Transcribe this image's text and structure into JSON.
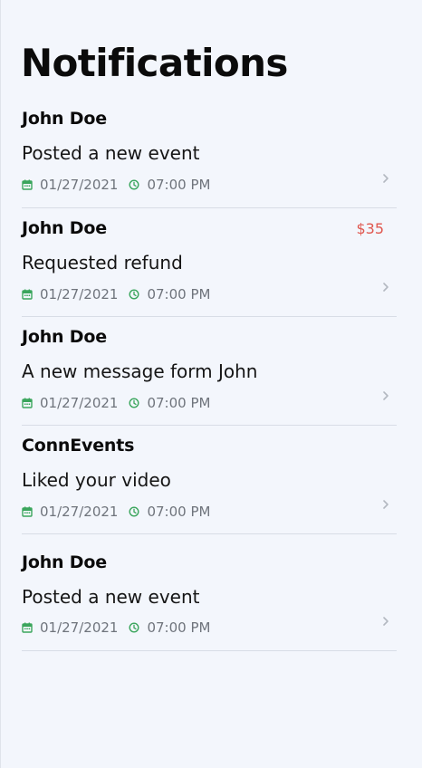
{
  "page": {
    "title": "Notifications"
  },
  "colors": {
    "accent_green": "#3aa55c",
    "amount_red": "#e0574f",
    "background": "#f3f6fc"
  },
  "icons": {
    "date": "calendar-icon",
    "time": "clock-icon",
    "open": "chevron-right-icon"
  },
  "notifications": [
    {
      "sender": "John Doe",
      "message": "Posted a new event",
      "date": "01/27/2021",
      "time": "07:00 PM",
      "amount": ""
    },
    {
      "sender": "John Doe",
      "message": "Requested refund",
      "date": "01/27/2021",
      "time": "07:00 PM",
      "amount": "$35"
    },
    {
      "sender": "John Doe",
      "message": "A new message form John",
      "date": "01/27/2021",
      "time": "07:00 PM",
      "amount": ""
    },
    {
      "sender": "ConnEvents",
      "message": "Liked your video",
      "date": "01/27/2021",
      "time": "07:00 PM",
      "amount": ""
    },
    {
      "sender": "John Doe",
      "message": "Posted a new event",
      "date": "01/27/2021",
      "time": "07:00 PM",
      "amount": ""
    }
  ]
}
